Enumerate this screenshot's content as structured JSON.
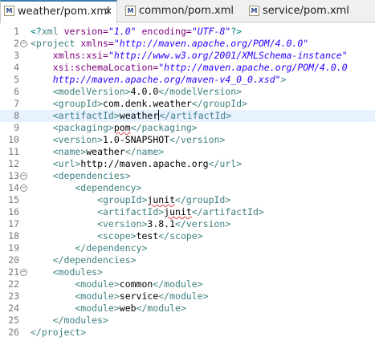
{
  "tabs": [
    {
      "label": "weather/pom.xml",
      "active": true,
      "icon": "maven-pom-file-icon",
      "closable": true
    },
    {
      "label": "common/pom.xml",
      "active": false,
      "icon": "maven-pom-file-icon"
    },
    {
      "label": "service/pom.xml",
      "active": false,
      "icon": "maven-pom-file-icon"
    }
  ],
  "icons": {
    "file_icon_letter": "M",
    "close_glyph": "✕",
    "fold_glyph": "−"
  },
  "editor": {
    "current_line": 8,
    "lines": [
      {
        "n": "1",
        "fold": false,
        "parts": [
          [
            "p",
            "<?"
          ],
          [
            "t",
            "xml "
          ],
          [
            "a",
            "version="
          ],
          [
            "s",
            "\"1.0\""
          ],
          [
            "a",
            " encoding="
          ],
          [
            "s",
            "\"UTF-8\""
          ],
          [
            "p",
            "?>"
          ]
        ]
      },
      {
        "n": "2",
        "fold": true,
        "parts": [
          [
            "t",
            "<project "
          ],
          [
            "a",
            "xmlns="
          ],
          [
            "s",
            "\"http://maven.apache.org/POM/4.0.0\""
          ]
        ]
      },
      {
        "n": "3",
        "fold": false,
        "parts": [
          [
            "a",
            "    xmlns:xsi="
          ],
          [
            "s",
            "\"http://www.w3.org/2001/XMLSchema-instance\""
          ]
        ]
      },
      {
        "n": "4",
        "fold": false,
        "parts": [
          [
            "a",
            "    xsi:schemaLocation="
          ],
          [
            "s",
            "\"http://maven.apache.org/POM/4.0.0"
          ]
        ]
      },
      {
        "n": "5",
        "fold": false,
        "parts": [
          [
            "s",
            "    http://maven.apache.org/maven-v4_0_0.xsd\""
          ],
          [
            "t",
            ">"
          ]
        ]
      },
      {
        "n": "6",
        "fold": false,
        "parts": [
          [
            "t",
            "    <modelVersion>"
          ],
          [
            "x",
            "4.0.0"
          ],
          [
            "t",
            "</modelVersion>"
          ]
        ]
      },
      {
        "n": "7",
        "fold": false,
        "parts": [
          [
            "t",
            "    <groupId>"
          ],
          [
            "x",
            "com.denk.weather"
          ],
          [
            "t",
            "</groupId>"
          ]
        ]
      },
      {
        "n": "8",
        "fold": false,
        "parts": [
          [
            "t",
            "    <artifactId>"
          ],
          [
            "x",
            "weather"
          ],
          [
            "caret",
            ""
          ],
          [
            "t",
            "</artifactId>"
          ]
        ]
      },
      {
        "n": "9",
        "fold": false,
        "parts": [
          [
            "t",
            "    <packaging>"
          ],
          [
            "xu",
            "pom"
          ],
          [
            "t",
            "</packaging>"
          ]
        ]
      },
      {
        "n": "10",
        "fold": false,
        "parts": [
          [
            "t",
            "    <version>"
          ],
          [
            "x",
            "1.0-SNAPSHOT"
          ],
          [
            "t",
            "</version>"
          ]
        ]
      },
      {
        "n": "11",
        "fold": false,
        "parts": [
          [
            "t",
            "    <name>"
          ],
          [
            "x",
            "weather"
          ],
          [
            "t",
            "</name>"
          ]
        ]
      },
      {
        "n": "12",
        "fold": false,
        "parts": [
          [
            "t",
            "    <url>"
          ],
          [
            "x",
            "http://maven.apache.org"
          ],
          [
            "t",
            "</url>"
          ]
        ]
      },
      {
        "n": "13",
        "fold": true,
        "parts": [
          [
            "t",
            "    <dependencies>"
          ]
        ]
      },
      {
        "n": "14",
        "fold": true,
        "parts": [
          [
            "t",
            "        <dependency>"
          ]
        ]
      },
      {
        "n": "15",
        "fold": false,
        "parts": [
          [
            "t",
            "            <groupId>"
          ],
          [
            "xu",
            "junit"
          ],
          [
            "t",
            "</groupId>"
          ]
        ]
      },
      {
        "n": "16",
        "fold": false,
        "parts": [
          [
            "t",
            "            <artifactId>"
          ],
          [
            "xu",
            "junit"
          ],
          [
            "t",
            "</artifactId>"
          ]
        ]
      },
      {
        "n": "17",
        "fold": false,
        "parts": [
          [
            "t",
            "            <version>"
          ],
          [
            "x",
            "3.8.1"
          ],
          [
            "t",
            "</version>"
          ]
        ]
      },
      {
        "n": "18",
        "fold": false,
        "parts": [
          [
            "t",
            "            <scope>"
          ],
          [
            "x",
            "test"
          ],
          [
            "t",
            "</scope>"
          ]
        ]
      },
      {
        "n": "19",
        "fold": false,
        "parts": [
          [
            "t",
            "        </dependency>"
          ]
        ]
      },
      {
        "n": "20",
        "fold": false,
        "parts": [
          [
            "t",
            "    </dependencies>"
          ]
        ]
      },
      {
        "n": "21",
        "fold": true,
        "parts": [
          [
            "t",
            "    <modules>"
          ]
        ]
      },
      {
        "n": "22",
        "fold": false,
        "parts": [
          [
            "t",
            "        <module>"
          ],
          [
            "x",
            "common"
          ],
          [
            "t",
            "</module>"
          ]
        ]
      },
      {
        "n": "23",
        "fold": false,
        "parts": [
          [
            "t",
            "        <module>"
          ],
          [
            "x",
            "service"
          ],
          [
            "t",
            "</module>"
          ]
        ]
      },
      {
        "n": "24",
        "fold": false,
        "parts": [
          [
            "t",
            "        <module>"
          ],
          [
            "x",
            "web"
          ],
          [
            "t",
            "</module>"
          ]
        ]
      },
      {
        "n": "25",
        "fold": false,
        "parts": [
          [
            "t",
            "    </modules>"
          ]
        ]
      },
      {
        "n": "26",
        "fold": false,
        "parts": [
          [
            "t",
            "</project>"
          ]
        ]
      }
    ]
  }
}
